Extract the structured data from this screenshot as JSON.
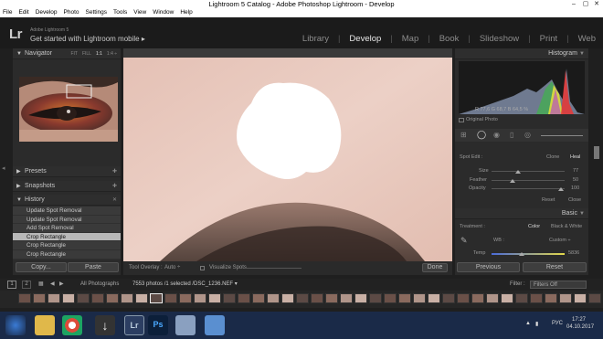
{
  "window": {
    "title": "Lightroom 5 Catalog - Adobe Photoshop Lightroom - Develop",
    "min": "–",
    "max": "▢",
    "close": "✕"
  },
  "menu": [
    "File",
    "Edit",
    "Develop",
    "Photo",
    "Settings",
    "Tools",
    "View",
    "Window",
    "Help"
  ],
  "identity": {
    "logo": "Lr",
    "product": "Adobe Lightroom 5",
    "tagline": "Get started with Lightroom mobile  ▸"
  },
  "modules": [
    "Library",
    "Develop",
    "Map",
    "Book",
    "Slideshow",
    "Print",
    "Web"
  ],
  "navigator": {
    "title": "Navigator",
    "zoom": [
      "FIT",
      "FILL",
      "1:1",
      "1:4 ÷"
    ]
  },
  "presets": {
    "title": "Presets"
  },
  "snapshots": {
    "title": "Snapshots"
  },
  "history": {
    "title": "History",
    "items": [
      "Update Spot Removal",
      "Update Spot Removal",
      "Add Spot Removal",
      "Crop Rectangle",
      "Crop Rectangle",
      "Crop Rectangle"
    ],
    "selected": 3
  },
  "left_buttons": {
    "copy": "Copy...",
    "paste": "Paste"
  },
  "toolbar": {
    "overlay_label": "Tool Overlay :",
    "overlay_value": "Auto ÷",
    "visualize": "Visualize Spots",
    "done": "Done"
  },
  "histogram": {
    "title": "Histogram",
    "readout": "R  77,6   G  68,7   B  64,5  %",
    "original": "Original Photo"
  },
  "spot": {
    "label": "Spot Edit :",
    "clone": "Clone",
    "heal": "Heal",
    "size_label": "Size",
    "size_value": "77",
    "feather_label": "Feather",
    "feather_value": "50",
    "opacity_label": "Opacity",
    "opacity_value": "100",
    "reset": "Reset",
    "close": "Close"
  },
  "basic": {
    "title": "Basic",
    "treatment_label": "Treatment :",
    "color": "Color",
    "bw": "Black & White",
    "wb_label": "WB :",
    "wb_value": "Custom ÷",
    "temp_label": "Temp",
    "temp_value": "5836"
  },
  "right_buttons": {
    "previous": "Previous",
    "reset": "Reset"
  },
  "filmstrip": {
    "page1": "1",
    "page2": "2",
    "source": "All Photographs",
    "count": "7553 photos /1 selected /DSC_1236.NEF ▾",
    "filter_label": "Filter :",
    "filter_value": "Filters Off"
  },
  "taskbar": {
    "lang": "РУС",
    "time": "17:27",
    "date": "04.10.2017"
  },
  "colors": {
    "accent": "#e7e7e7",
    "panel": "#2b2b2b",
    "skin": "#e8cbc1",
    "taskbar": "#1a2a48"
  }
}
